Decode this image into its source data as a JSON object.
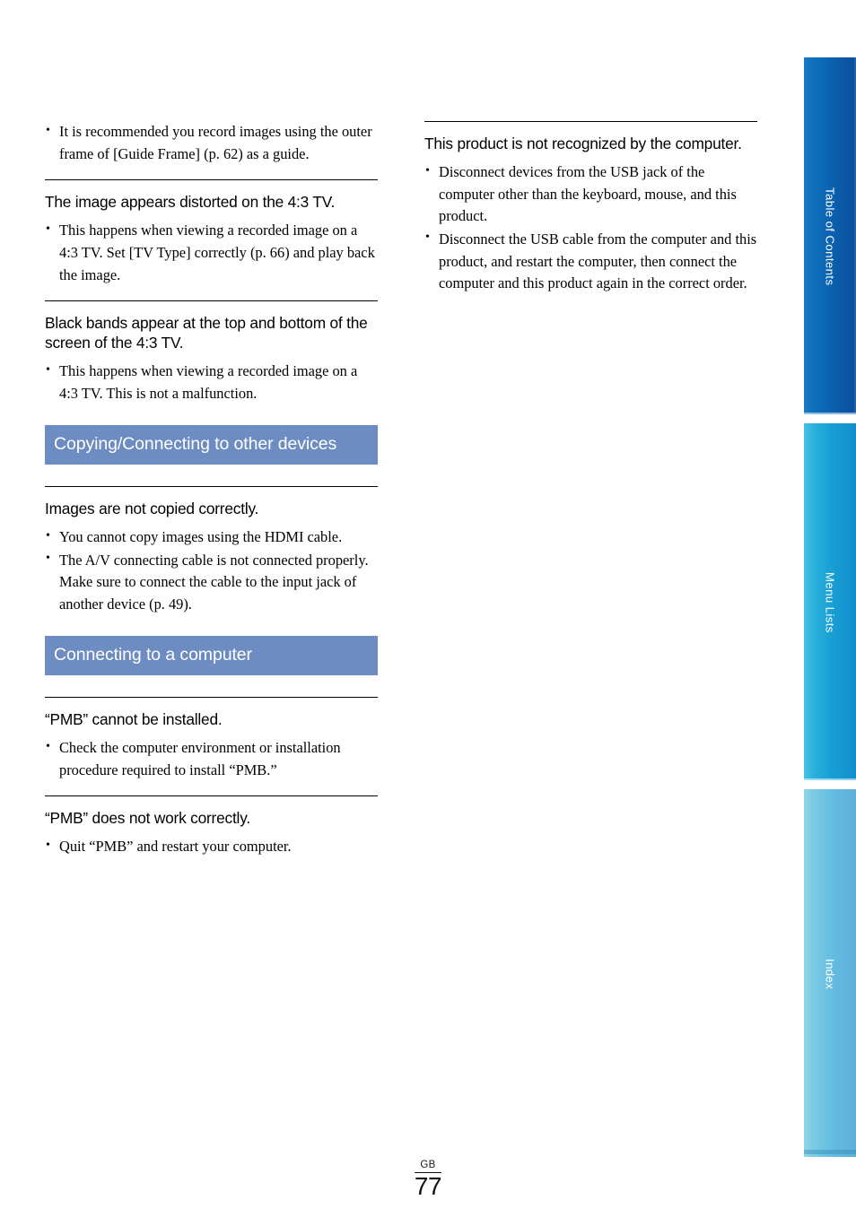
{
  "page": {
    "folio_region": "GB",
    "folio_number": "77",
    "band_color": "#6d8cc2",
    "rule_color": "#000000"
  },
  "left_column": {
    "blocks": [
      {
        "type": "qa",
        "heading": "",
        "bullets": [
          "It is recommended you record images using the outer frame of [Guide Frame] (p. 62) as a guide."
        ]
      },
      {
        "type": "qa",
        "heading": "The image appears distorted on the 4:3 TV.",
        "bullets": [
          "This happens when viewing a recorded image on a 4:3 TV. Set [TV Type] correctly (p. 66) and play back the image."
        ]
      },
      {
        "type": "qa",
        "heading": "Black bands appear at the top and bottom of the screen of the 4:3 TV.",
        "bullets": [
          "This happens when viewing a recorded image on a 4:3 TV. This is not a malfunction."
        ]
      },
      {
        "type": "band",
        "title": "Copying/Connecting to other devices"
      },
      {
        "type": "qa",
        "heading": "Images are not copied correctly.",
        "bullets": [
          "You cannot copy images using the HDMI cable.",
          "The A/V connecting cable is not connected properly. Make sure to connect the cable to the input jack of another device (p. 49)."
        ]
      },
      {
        "type": "band",
        "title": "Connecting to a computer"
      },
      {
        "type": "qa",
        "heading": "“PMB” cannot be installed.",
        "bullets": [
          "Check the computer environment or installation procedure required to install “PMB.”"
        ]
      },
      {
        "type": "qa",
        "heading": "“PMB” does not work correctly.",
        "bullets": [
          "Quit “PMB” and restart your computer."
        ]
      }
    ]
  },
  "right_column": {
    "blocks": [
      {
        "type": "qa",
        "heading": "This product is not recognized by the computer.",
        "bullets": [
          "Disconnect devices from the USB jack of the computer other than the keyboard, mouse, and this product.",
          "Disconnect the USB cable from the computer and this product, and restart the computer, then connect the computer and this product again in the correct order."
        ]
      }
    ]
  },
  "sidebar": {
    "tabs": [
      {
        "label": "Table of Contents",
        "color": "#0a5fae"
      },
      {
        "label": "Menu Lists",
        "color": "#189fd4"
      },
      {
        "label": "Index",
        "color": "#63bce0"
      }
    ]
  }
}
